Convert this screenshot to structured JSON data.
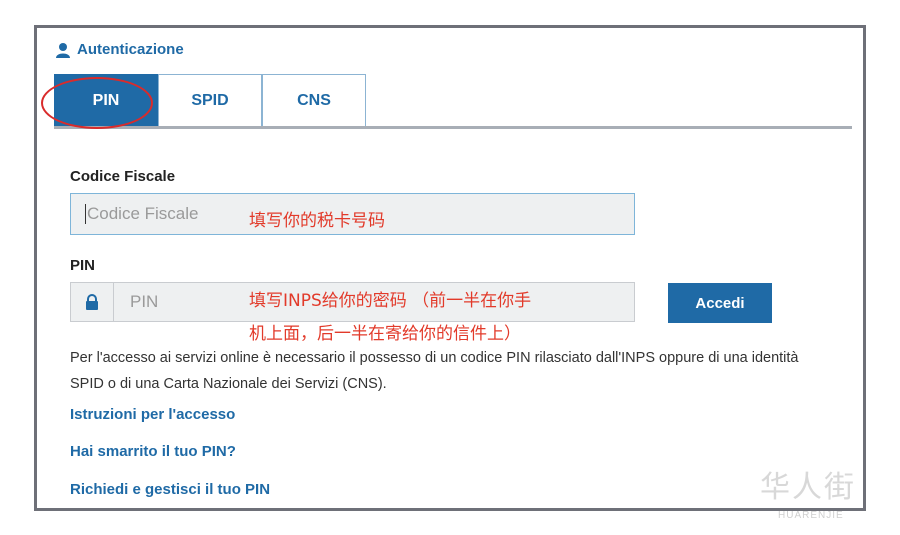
{
  "header": {
    "title": "Autenticazione",
    "icon": "user-icon"
  },
  "tabs": [
    {
      "label": "PIN",
      "active": true
    },
    {
      "label": "SPID",
      "active": false
    },
    {
      "label": "CNS",
      "active": false
    }
  ],
  "form": {
    "cf_label": "Codice Fiscale",
    "cf_placeholder": "Codice Fiscale",
    "pin_label": "PIN",
    "pin_placeholder": "PIN",
    "submit_label": "Accedi"
  },
  "annotations": {
    "cf_note": "填写你的税卡号码",
    "pin_note_line1": "填写INPS给你的密码 （前一半在你手",
    "pin_note_line2": "机上面，后一半在寄给你的信件上）"
  },
  "description": "Per l'accesso ai servizi online è necessario il possesso di un codice PIN rilasciato dall'INPS oppure di una identità SPID o di una Carta Nazionale dei Servizi (CNS).",
  "links": [
    "Istruzioni per l'accesso",
    "Hai smarrito il tuo PIN?",
    "Richiedi e gestisci il tuo PIN"
  ],
  "watermark": {
    "main": "华人街",
    "sub": "HUARENJIE"
  },
  "colors": {
    "accent": "#1f6aa6",
    "annotation": "#e23a2a",
    "highlight_circle": "#d92b2b"
  }
}
